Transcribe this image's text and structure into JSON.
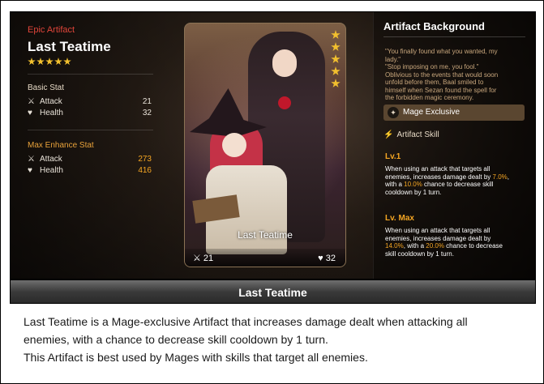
{
  "artifact": {
    "rarity": "Epic Artifact",
    "name": "Last Teatime",
    "star_count": 5
  },
  "basic_stat": {
    "title": "Basic Stat",
    "attack_label": "Attack",
    "attack_value": "21",
    "health_label": "Health",
    "health_value": "32"
  },
  "max_stat": {
    "title": "Max Enhance Stat",
    "attack_label": "Attack",
    "attack_value": "273",
    "health_label": "Health",
    "health_value": "416"
  },
  "card": {
    "name": "Last Teatime",
    "attack": "21",
    "health": "32"
  },
  "background": {
    "title": "Artifact Background",
    "lore_lines": [
      "\"You finally found what you wanted, my",
      "lady.\"",
      "\"Stop imposing on me, you fool.\"",
      "Oblivious to the events that would soon",
      "unfold before them, Baal smiled to",
      "himself when Sezan found the spell for",
      "the forbidden magic ceremony."
    ],
    "exclusive_label": "Mage Exclusive",
    "skill_title": "Artifact Skill",
    "lv1": {
      "label": "Lv.1",
      "line1": "When using an attack that targets all",
      "line2a": "enemies, increases damage dealt by ",
      "line2b": "7.0%",
      "line2c": ",",
      "line3a": "with a ",
      "line3b": "10.0%",
      "line3c": " chance to decrease skill",
      "line4": "cooldown by 1 turn."
    },
    "lvmax": {
      "label": "Lv. Max",
      "line1": "When using an attack that targets all",
      "line2": "enemies, increases damage dealt by",
      "line3a": "14.0%",
      "line3b": ", with a ",
      "line3c": "20.0%",
      "line3d": " chance to decrease",
      "line4": "skill cooldown by 1 turn."
    }
  },
  "caption": {
    "title": "Last Teatime",
    "line1": "Last Teatime is a Mage-exclusive Artifact that increases damage dealt when attacking all",
    "line2": "enemies, with a chance to decrease skill cooldown by 1 turn.",
    "line3": "This Artifact is best used by Mages with skills that target all enemies."
  },
  "colors": {
    "rarity": "#e0453a",
    "section_title": "#e8a23a",
    "highlight": "#f5a623",
    "star": "#f2c02e",
    "lore": "#c9a77d"
  }
}
